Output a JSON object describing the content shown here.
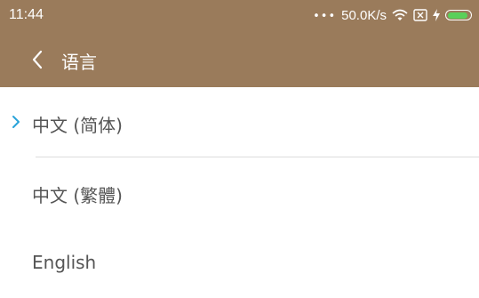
{
  "status_bar": {
    "time": "11:44",
    "dots": "•••",
    "speed": "50.0K/s",
    "icons": [
      "wifi-icon",
      "sim-card-icon",
      "charging-bolt-icon",
      "battery-icon"
    ],
    "battery_level": 0.9
  },
  "header": {
    "title": "语言",
    "background": "#9a7b5b"
  },
  "languages": [
    {
      "label": "中文 (简体)",
      "selected": true
    },
    {
      "label": "中文 (繁體)",
      "selected": false
    },
    {
      "label": "English",
      "selected": false
    }
  ],
  "colors": {
    "accent": "#29a3d9",
    "battery": "#5ad05a"
  }
}
